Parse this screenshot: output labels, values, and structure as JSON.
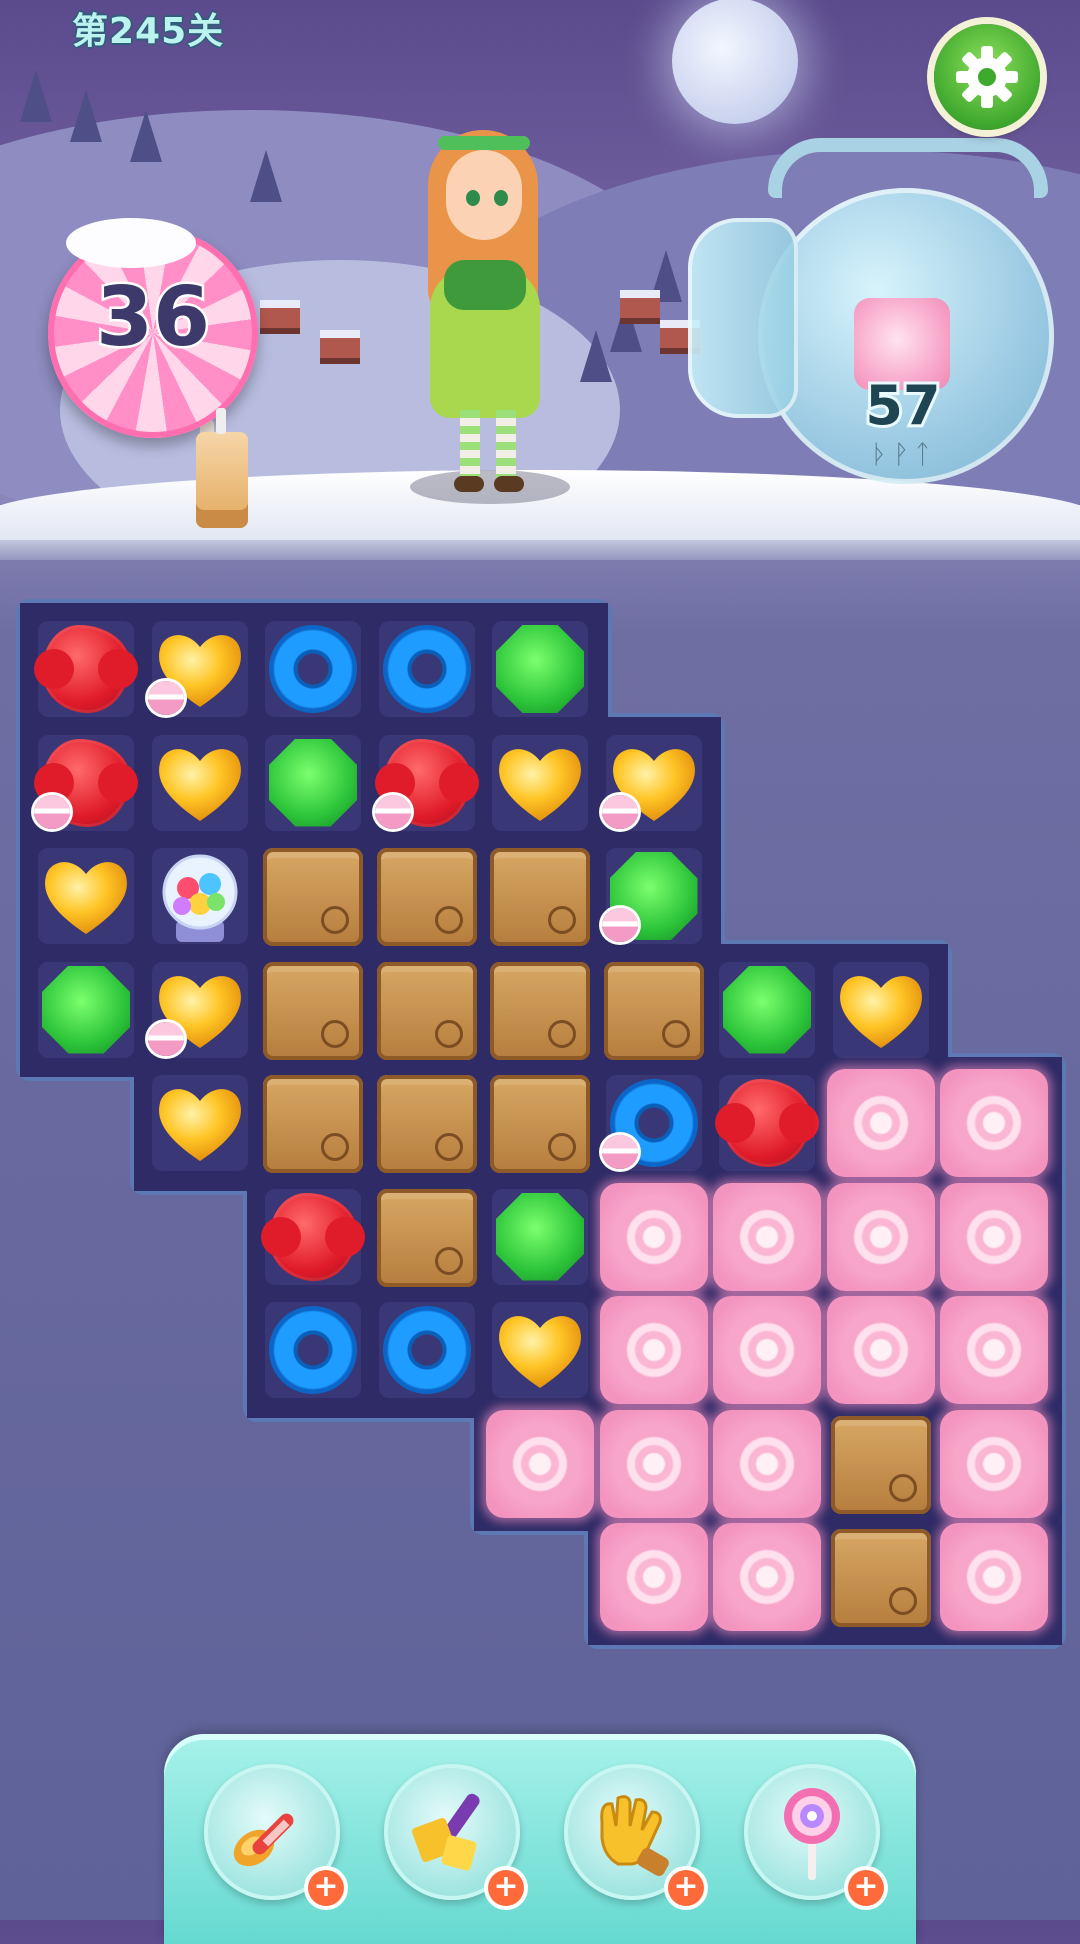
{
  "level": {
    "title": "第245关"
  },
  "moves": {
    "remaining": "36"
  },
  "goal": {
    "target_icon": "pink-swirl-candy-icon",
    "count": "57",
    "jar_runes": "ᚦᚹᛏ"
  },
  "settings": {
    "icon": "gear-icon"
  },
  "board": {
    "rows": 9,
    "cols": 9,
    "legend": {
      "R": "red-flower-candy",
      "Y": "yellow-heart-candy",
      "B": "blue-donut-candy",
      "G": "green-octagon-candy",
      "X": "wooden-crate-blocker",
      "P": "pink-swirl-cake-blocker",
      "M": "gumball-machine-booster",
      "m": "macaron-marker"
    },
    "cells": [
      [
        "R",
        "Ym",
        "B",
        "B",
        "G",
        null,
        null,
        null,
        null
      ],
      [
        "Rm",
        "Y",
        "G",
        "Rm",
        "Y",
        "Ym",
        null,
        null,
        null
      ],
      [
        "Y",
        "M",
        "X",
        "X",
        "X",
        "Gm",
        null,
        null,
        null
      ],
      [
        "G",
        "Ym",
        "X",
        "X",
        "X",
        "X",
        "G",
        "Y",
        null
      ],
      [
        null,
        "Y",
        "X",
        "X",
        "X",
        "Bm",
        "R",
        "P",
        "P"
      ],
      [
        null,
        null,
        "R",
        "X",
        "G",
        "P",
        "P",
        "P",
        "P"
      ],
      [
        null,
        null,
        "B",
        "B",
        "Y",
        "P",
        "P",
        "P",
        "P"
      ],
      [
        null,
        null,
        null,
        null,
        "P",
        "P",
        "P",
        "X",
        "P"
      ],
      [
        null,
        null,
        null,
        null,
        null,
        "P",
        "P",
        "X",
        "P"
      ]
    ]
  },
  "boosters": [
    {
      "name": "spoon-booster",
      "icon": "spoon-icon"
    },
    {
      "name": "candy-hammer-booster",
      "icon": "hammer-icon"
    },
    {
      "name": "glove-booster",
      "icon": "glove-icon"
    },
    {
      "name": "lollipop-booster",
      "icon": "lollipop-icon"
    }
  ],
  "add_booster_symbol": "+",
  "colors": {
    "accent_green": "#3fa82e",
    "board_bg": "#2e2b66",
    "booster_bar": "#a6f2ea",
    "plus_badge": "#ff6a3a"
  }
}
